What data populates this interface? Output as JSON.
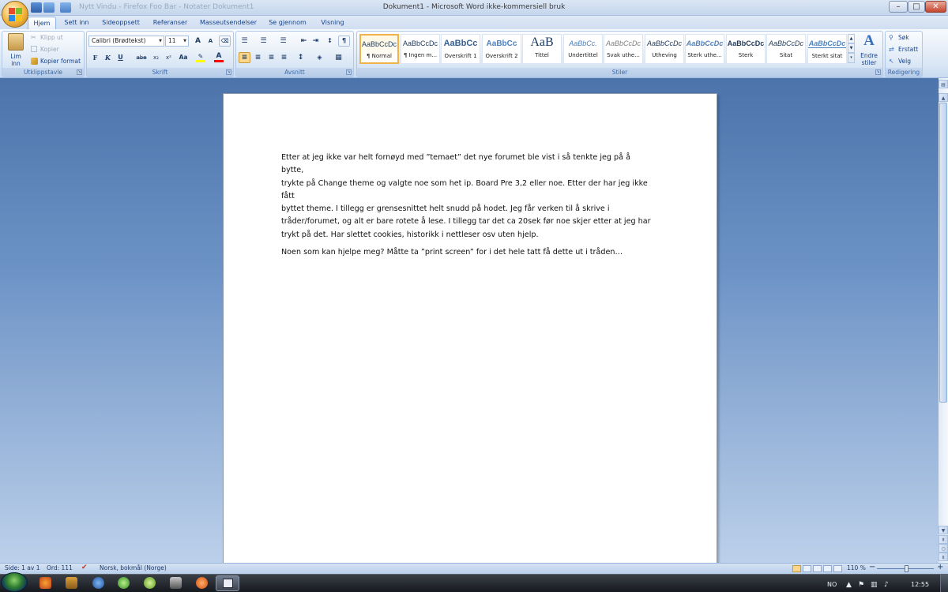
{
  "window": {
    "title": "Dokument1 - Microsoft Word ikke-kommersiell bruk",
    "faded_titles": "Nytt Vindu - Firefox Foo Bar - Notater  Dokument1",
    "minimize": "–",
    "maximize": "□",
    "close": "✕"
  },
  "tabs": [
    "Hjem",
    "Sett inn",
    "Sideoppsett",
    "Referanser",
    "Masseutsendelser",
    "Se gjennom",
    "Visning"
  ],
  "clipboard": {
    "paste": "Lim inn",
    "cut": "Klipp ut",
    "copy": "Kopier",
    "format_painter": "Kopier format",
    "label": "Utklippstavle"
  },
  "font": {
    "family": "Calibri (Brødtekst)",
    "size": "11",
    "label": "Skrift",
    "grow": "A",
    "shrink": "A",
    "bold": "F",
    "italic": "K",
    "underline": "U",
    "strike": "abe",
    "subscript": "x₂",
    "superscript": "x²",
    "case": "Aa"
  },
  "paragraph": {
    "label": "Avsnitt",
    "pilcrow": "¶"
  },
  "styles": {
    "label": "Stiler",
    "items": [
      {
        "preview": "AaBbCcDc",
        "name": "¶ Normal"
      },
      {
        "preview": "AaBbCcDc",
        "name": "¶ Ingen m..."
      },
      {
        "preview": "AaBbCc",
        "name": "Overskrift 1"
      },
      {
        "preview": "AaBbCc",
        "name": "Overskrift 2"
      },
      {
        "preview": "AaB",
        "name": "Tittel"
      },
      {
        "preview": "AaBbCc.",
        "name": "Undertittel"
      },
      {
        "preview": "AaBbCcDc",
        "name": "Svak uthe..."
      },
      {
        "preview": "AaBbCcDc",
        "name": "Utheving"
      },
      {
        "preview": "AaBbCcDc",
        "name": "Sterk uthe..."
      },
      {
        "preview": "AaBbCcDc",
        "name": "Sterk"
      },
      {
        "preview": "AaBbCcDc",
        "name": "Sitat"
      },
      {
        "preview": "AaBbCcDc",
        "name": "Sterkt sitat"
      }
    ],
    "change": "Endre stiler"
  },
  "editing": {
    "label": "Redigering",
    "find": "Søk",
    "replace": "Erstatt",
    "select": "Velg"
  },
  "document": {
    "paragraph1": "Etter at jeg ikke var helt fornøyd med ”temaet” det nye forumet ble vist i så tenkte jeg på å bytte,\ntrykte på Change theme og valgte noe som het ip. Board Pre 3,2 eller noe. Etter der har jeg ikke fått\nbyttet theme. I tillegg er grensesnittet helt snudd på hodet. Jeg får verken til å skrive i\ntråder/forumet, og alt er bare rotete å lese. I tillegg tar det ca 20sek før noe skjer etter at jeg har\ntrykt på det. Har slettet cookies, historikk i nettleser osv uten hjelp.",
    "paragraph2": "Noen som kan hjelpe meg? Måtte ta ”print screen” for i det hele tatt få dette ut i tråden…"
  },
  "status": {
    "page": "Side: 1 av 1",
    "words": "Ord: 111",
    "language": "Norsk, bokmål (Norge)",
    "zoom": "110 %",
    "zoom_minus": "−",
    "zoom_plus": "+"
  },
  "taskbar": {
    "lang": "NO",
    "clock": "12:55"
  },
  "colors": {
    "accent": "#15428b",
    "highlight": "#ffff00",
    "font_color": "#ff0000"
  }
}
